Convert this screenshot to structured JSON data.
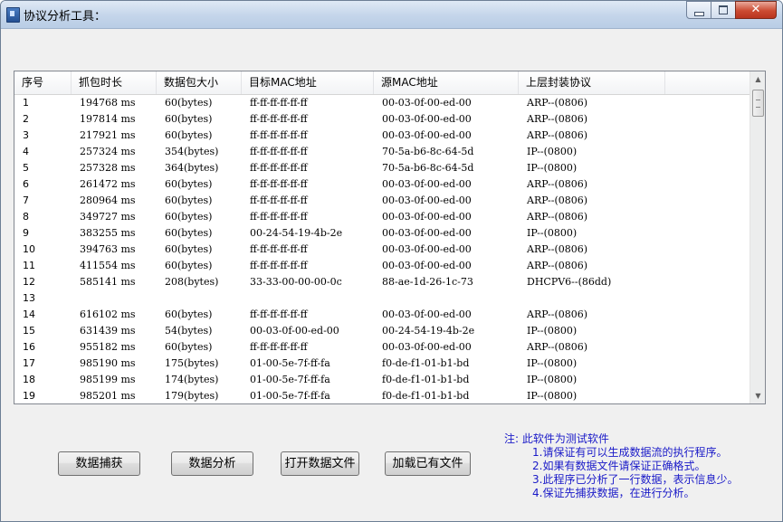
{
  "window": {
    "title": "协议分析工具："
  },
  "table": {
    "columns": [
      "序号",
      "抓包时长",
      "数据包大小",
      "目标MAC地址",
      "源MAC地址",
      "上层封装协议"
    ],
    "rows": [
      [
        "1",
        "194768 ms",
        "60(bytes)",
        "ff-ff-ff-ff-ff-ff",
        "00-03-0f-00-ed-00",
        "ARP--(0806)"
      ],
      [
        "2",
        "197814 ms",
        "60(bytes)",
        "ff-ff-ff-ff-ff-ff",
        "00-03-0f-00-ed-00",
        "ARP--(0806)"
      ],
      [
        "3",
        "217921 ms",
        "60(bytes)",
        "ff-ff-ff-ff-ff-ff",
        "00-03-0f-00-ed-00",
        "ARP--(0806)"
      ],
      [
        "4",
        "257324 ms",
        "354(bytes)",
        "ff-ff-ff-ff-ff-ff",
        "70-5a-b6-8c-64-5d",
        "IP--(0800)"
      ],
      [
        "5",
        "257328 ms",
        "364(bytes)",
        "ff-ff-ff-ff-ff-ff",
        "70-5a-b6-8c-64-5d",
        "IP--(0800)"
      ],
      [
        "6",
        "261472 ms",
        "60(bytes)",
        "ff-ff-ff-ff-ff-ff",
        "00-03-0f-00-ed-00",
        "ARP--(0806)"
      ],
      [
        "7",
        "280964 ms",
        "60(bytes)",
        "ff-ff-ff-ff-ff-ff",
        "00-03-0f-00-ed-00",
        "ARP--(0806)"
      ],
      [
        "8",
        "349727 ms",
        "60(bytes)",
        "ff-ff-ff-ff-ff-ff",
        "00-03-0f-00-ed-00",
        "ARP--(0806)"
      ],
      [
        "9",
        "383255 ms",
        "60(bytes)",
        "00-24-54-19-4b-2e",
        "00-03-0f-00-ed-00",
        "IP--(0800)"
      ],
      [
        "10",
        "394763 ms",
        "60(bytes)",
        "ff-ff-ff-ff-ff-ff",
        "00-03-0f-00-ed-00",
        "ARP--(0806)"
      ],
      [
        "11",
        "411554 ms",
        "60(bytes)",
        "ff-ff-ff-ff-ff-ff",
        "00-03-0f-00-ed-00",
        "ARP--(0806)"
      ],
      [
        "12",
        "585141 ms",
        "208(bytes)",
        "33-33-00-00-00-0c",
        "88-ae-1d-26-1c-73",
        "DHCPV6--(86dd)"
      ],
      [
        "13",
        "",
        "",
        "",
        "",
        ""
      ],
      [
        "14",
        "616102 ms",
        "60(bytes)",
        "ff-ff-ff-ff-ff-ff",
        "00-03-0f-00-ed-00",
        "ARP--(0806)"
      ],
      [
        "15",
        "631439 ms",
        "54(bytes)",
        "00-03-0f-00-ed-00",
        "00-24-54-19-4b-2e",
        "IP--(0800)"
      ],
      [
        "16",
        "955182 ms",
        "60(bytes)",
        "ff-ff-ff-ff-ff-ff",
        "00-03-0f-00-ed-00",
        "ARP--(0806)"
      ],
      [
        "17",
        "985190 ms",
        "175(bytes)",
        "01-00-5e-7f-ff-fa",
        "f0-de-f1-01-b1-bd",
        "IP--(0800)"
      ],
      [
        "18",
        "985199 ms",
        "174(bytes)",
        "01-00-5e-7f-ff-fa",
        "f0-de-f1-01-b1-bd",
        "IP--(0800)"
      ],
      [
        "19",
        "985201 ms",
        "179(bytes)",
        "01-00-5e-7f-ff-fa",
        "f0-de-f1-01-b1-bd",
        "IP--(0800)"
      ]
    ]
  },
  "buttons": {
    "capture": "数据捕获",
    "analyze": "数据分析",
    "open_file": "打开数据文件",
    "load_file": "加载已有文件"
  },
  "note": {
    "title": "注: 此软件为测试软件",
    "lines": [
      "1.请保证有可以生成数据流的执行程序。",
      "2.如果有数据文件请保证正确格式。",
      "3.此程序已分析了一行数据，表示信息少。",
      "4.保证先捕获数据，在进行分析。"
    ]
  },
  "colors": {
    "note_text": "#1a1ac8",
    "window_bg": "#f0f0f0"
  }
}
